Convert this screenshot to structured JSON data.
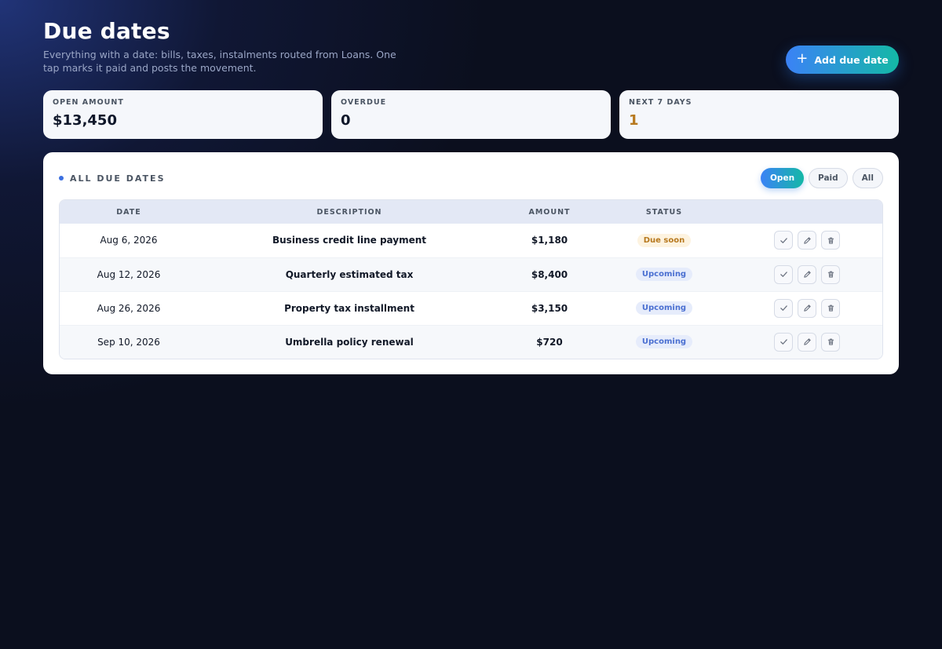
{
  "header": {
    "title": "Due dates",
    "subtitle": "Everything with a date: bills, taxes, instalments routed from Loans. One tap marks it paid and posts the movement.",
    "add_label": "Add due date"
  },
  "stats": [
    {
      "label": "OPEN AMOUNT",
      "value": "$13,450"
    },
    {
      "label": "OVERDUE",
      "value": "0"
    },
    {
      "label": "NEXT 7 DAYS",
      "value": "1"
    }
  ],
  "panel": {
    "title": "ALL DUE DATES",
    "filters": [
      "Open",
      "Paid",
      "All"
    ],
    "active_filter": "Open"
  },
  "table": {
    "columns": [
      "DATE",
      "DESCRIPTION",
      "AMOUNT",
      "STATUS",
      ""
    ],
    "rows": [
      {
        "date": "Aug 6, 2026",
        "description": "Business credit line payment",
        "amount": "$1,180",
        "status": "Due soon"
      },
      {
        "date": "Aug 12, 2026",
        "description": "Quarterly estimated tax",
        "amount": "$8,400",
        "status": "Upcoming"
      },
      {
        "date": "Aug 26, 2026",
        "description": "Property tax installment",
        "amount": "$3,150",
        "status": "Upcoming"
      },
      {
        "date": "Sep 10, 2026",
        "description": "Umbrella policy renewal",
        "amount": "$720",
        "status": "Upcoming"
      }
    ]
  },
  "colors": {
    "accent_start": "#3b82f6",
    "accent_end": "#14b8a6",
    "due_soon": "#b7791f",
    "upcoming": "#4a6fd1",
    "background": "#0b0f1e"
  },
  "icons": {
    "add": "plus-icon",
    "mark_paid": "check-icon",
    "edit": "pencil-icon",
    "delete": "trash-icon"
  }
}
